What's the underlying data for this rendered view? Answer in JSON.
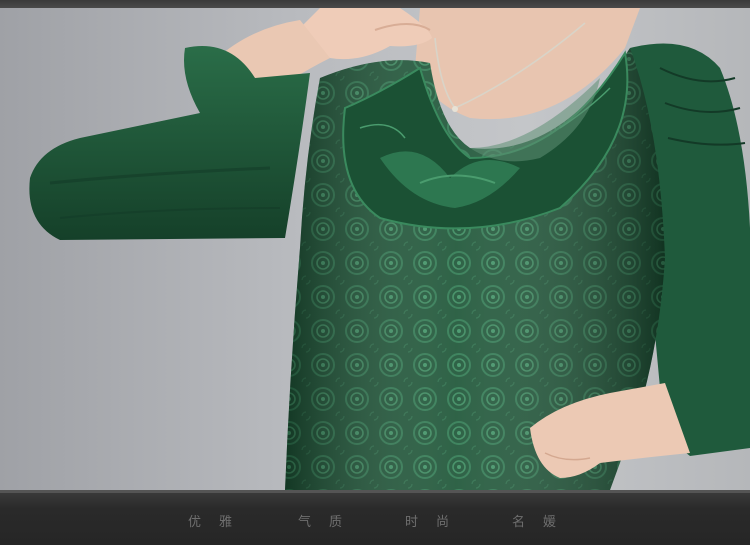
{
  "caption": {
    "word_1": "优雅",
    "word_2": "气质",
    "word_3": "时尚",
    "word_4": "名媛"
  },
  "colors": {
    "garment": "#1f5a3c",
    "garment_dark": "#123826",
    "skin": "#e9c6b2",
    "background": "#b9bbbf",
    "band": "#2b2b2b"
  }
}
